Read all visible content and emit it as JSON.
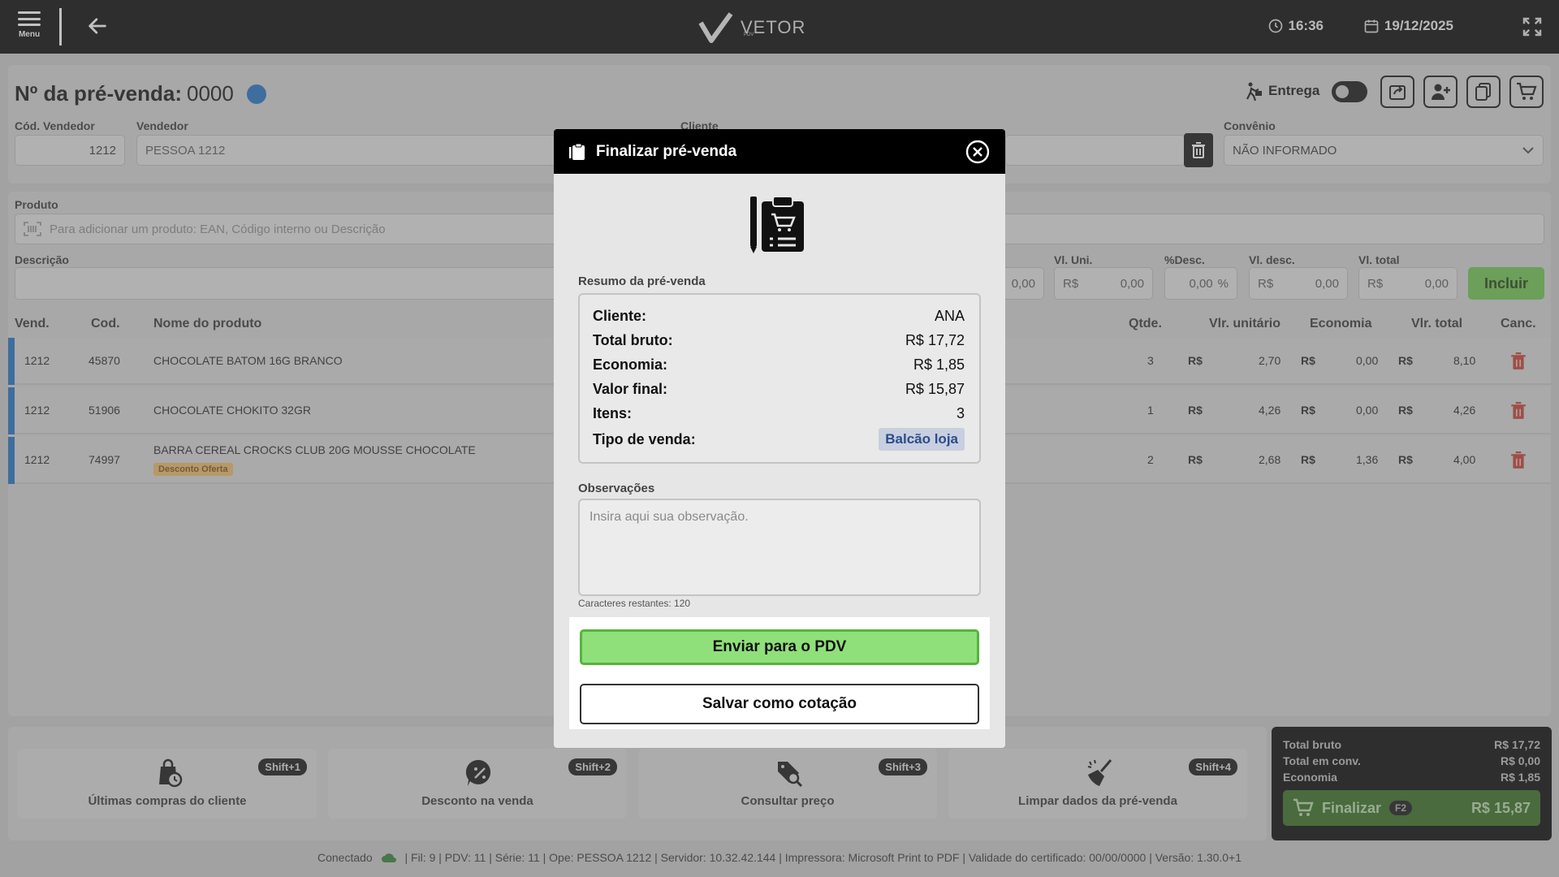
{
  "topbar": {
    "menu_label": "Menu",
    "logo_text": "VETOR",
    "logo_sub": "PDV",
    "time": "16:36",
    "date": "19/12/2025"
  },
  "header": {
    "title_label": "Nº da pré-venda:",
    "title_number": "0000",
    "cod_vendedor_label": "Cód. Vendedor",
    "cod_vendedor_value": "1212",
    "vendedor_label": "Vendedor",
    "vendedor_value": "PESSOA 1212",
    "cliente_label": "Cliente",
    "convenio_label": "Convênio",
    "convenio_value": "NÃO INFORMADO",
    "entrega_label": "Entrega"
  },
  "product": {
    "produto_label": "Produto",
    "produto_placeholder": "Para adicionar um produto: EAN, Código interno ou Descrição",
    "descricao_label": "Descrição",
    "partial_value": "0,00",
    "vl_uni_label": "Vl. Uni.",
    "vl_uni_value": "0,00",
    "desc_pct_label": "%Desc.",
    "desc_pct_value": "0,00",
    "vl_desc_label": "Vl. desc.",
    "vl_desc_value": "0,00",
    "vl_total_label": "Vl. total",
    "vl_total_value": "0,00",
    "currency": "R$",
    "pct": "%",
    "incluir_label": "Incluir"
  },
  "table": {
    "headers": {
      "vend": "Vend.",
      "cod": "Cod.",
      "nome": "Nome do produto",
      "qtde": "Qtde.",
      "vlr_unit": "Vlr. unitário",
      "economia": "Economia",
      "vlr_total": "Vlr. total",
      "canc": "Canc."
    },
    "rows": [
      {
        "vend": "1212",
        "cod": "45870",
        "nome": "CHOCOLATE BATOM 16G BRANCO",
        "qtde": "3",
        "unit": "2,70",
        "econ": "0,00",
        "total": "8,10"
      },
      {
        "vend": "1212",
        "cod": "51906",
        "nome": "CHOCOLATE CHOKITO 32GR",
        "qtde": "1",
        "unit": "4,26",
        "econ": "0,00",
        "total": "4,26"
      },
      {
        "vend": "1212",
        "cod": "74997",
        "nome": "BARRA CEREAL CROCKS CLUB 20G MOUSSE CHOCOLATE",
        "badge": "Desconto Oferta",
        "qtde": "2",
        "unit": "2,68",
        "econ": "1,36",
        "total": "4,00"
      }
    ]
  },
  "actions": [
    {
      "label": "Últimas compras do cliente",
      "shortcut": "Shift+1"
    },
    {
      "label": "Desconto na venda",
      "shortcut": "Shift+2"
    },
    {
      "label": "Consultar preço",
      "shortcut": "Shift+3"
    },
    {
      "label": "Limpar dados da pré-venda",
      "shortcut": "Shift+4"
    }
  ],
  "totals": {
    "bruto_label": "Total bruto",
    "bruto_value": "R$ 17,72",
    "conv_label": "Total em conv.",
    "conv_value": "R$ 0,00",
    "econ_label": "Economia",
    "econ_value": "R$ 1,85",
    "finalizar_label": "Finalizar",
    "finalizar_key": "F2",
    "finalizar_value": "R$ 15,87"
  },
  "status": {
    "conectado": "Conectado",
    "details": "| Fil: 9 | PDV: 11 | Série: 11 | Ope: PESSOA 1212 | Servidor: 10.32.42.144 | Impressora: Microsoft Print to PDF | Validade do certificado: 00/00/0000 | Versão: 1.30.0+1"
  },
  "modal": {
    "title": "Finalizar pré-venda",
    "resumo_label": "Resumo da pré-venda",
    "rows": [
      {
        "k": "Cliente:",
        "v": "ANA"
      },
      {
        "k": "Total bruto:",
        "v": "R$ 17,72"
      },
      {
        "k": "Economia:",
        "v": "R$ 1,85"
      },
      {
        "k": "Valor final:",
        "v": "R$ 15,87"
      },
      {
        "k": "Itens:",
        "v": "3"
      }
    ],
    "tipo_label": "Tipo de venda:",
    "tipo_value": "Balcão loja",
    "obs_label": "Observações",
    "obs_placeholder": "Insira aqui sua observação.",
    "chars_remaining": "Caracteres restantes: 120",
    "send_label": "Enviar para o PDV",
    "save_label": "Salvar como cotação"
  },
  "colors": {
    "accent_blue": "#1d6fc1",
    "success_green": "#8fe07a",
    "danger_red": "#c0392b"
  }
}
